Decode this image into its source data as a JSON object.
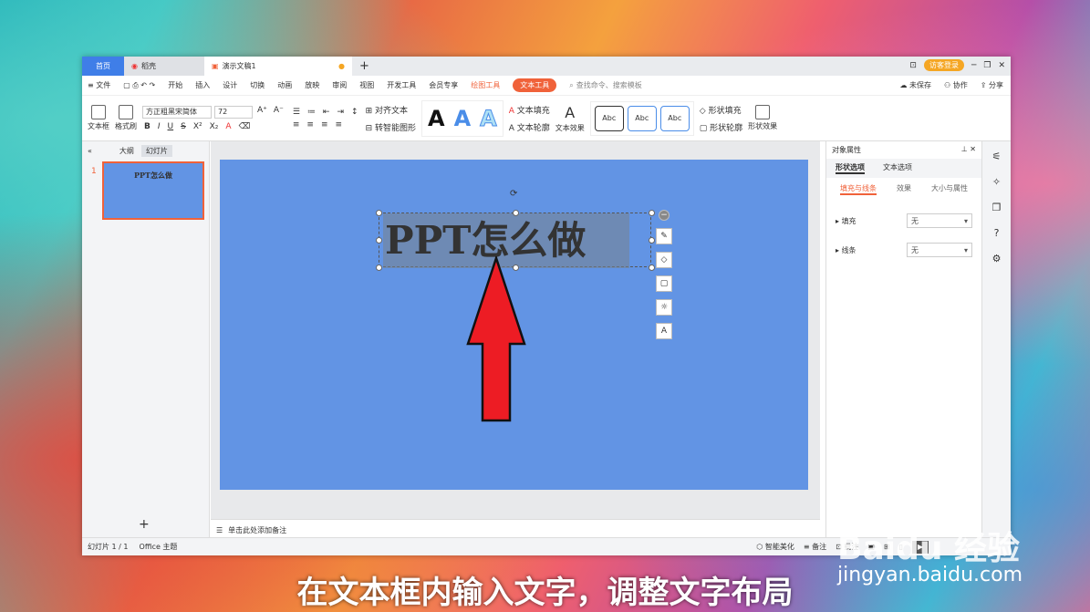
{
  "titlebar": {
    "home": "首页",
    "daoke": "稻壳",
    "doc": "演示文稿1",
    "add": "+",
    "guest": "访客登录"
  },
  "menu": {
    "file": "文件",
    "items": [
      "开始",
      "插入",
      "设计",
      "切换",
      "动画",
      "放映",
      "审阅",
      "视图",
      "开发工具",
      "会员专享"
    ],
    "draw_tools": "绘图工具",
    "text_tools": "文本工具",
    "search": "查找命令、搜索模板",
    "unsaved": "未保存",
    "collab": "协作",
    "share": "分享"
  },
  "ribbon": {
    "textbox": "文本框",
    "format_painter": "格式刷",
    "font_name": "方正粗黑宋简体",
    "font_size": "72",
    "align_text": "对齐文本",
    "smartart": "转智能图形",
    "text_fill": "文本填充",
    "text_outline": "文本轮廓",
    "text_effect": "文本效果",
    "abc": "Abc",
    "shape_fill": "形状填充",
    "shape_outline": "形状轮廓",
    "shape_effect": "形状效果"
  },
  "left": {
    "outline": "大纲",
    "slides": "幻灯片",
    "slide_num": "1",
    "thumb_title": "PPT怎么做",
    "add": "+"
  },
  "slide": {
    "title": "PPT怎么做"
  },
  "notes": {
    "placeholder": "单击此处添加备注"
  },
  "right": {
    "header": "对象属性",
    "tab_shape": "形状选项",
    "tab_text": "文本选项",
    "sub_fill": "填充与线条",
    "sub_effect": "效果",
    "sub_size": "大小与属性",
    "fill": "填充",
    "fill_val": "无",
    "line": "线条",
    "line_val": "无"
  },
  "status": {
    "slide_count": "幻灯片 1 / 1",
    "theme": "Office 主题",
    "beautify": "智能美化",
    "notes": "备注",
    "comments": "批注"
  },
  "caption": "在文本框内输入文字，调整文字布局",
  "watermark": {
    "brand": "Baidu 经验",
    "url": "jingyan.baidu.com"
  }
}
